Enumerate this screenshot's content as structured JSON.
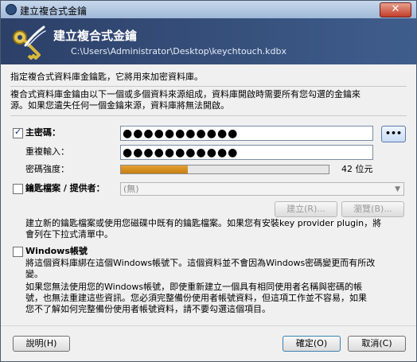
{
  "window": {
    "title": "建立複合式金鑰",
    "close_symbol": "✕"
  },
  "banner": {
    "title": "建立複合式金鑰",
    "path": "C:\\Users\\Administrator\\Desktop\\keychtouch.kdbx"
  },
  "intro": {
    "line1": "指定複合式資料庫金鑰匙，它將用來加密資料庫。",
    "line2": "複合式資料庫金鑰由以下一個或多個資料來源組成，資料庫開啟時需要所有您勾選的金鑰來",
    "line3": "源。如果您遺失任何一個金鑰來源，資料庫將無法開啟。"
  },
  "master_password": {
    "label": "主密碼：",
    "value": "●●●●●●●●●●●",
    "repeat_label": "重複輸入：",
    "repeat_value": "●●●●●●●●●●●",
    "toggle_label": "•••",
    "strength_label": "密碼強度：",
    "strength_text": "42 位元",
    "strength_fraction": 0.32
  },
  "key_file": {
    "label": "鑰匙檔案 / 提供者：",
    "select_value": "(無)",
    "create_label": "建立(R)...",
    "browse_label": "瀏覽(B)...",
    "help_line1": "建立新的鑰匙檔案或使用您磁碟中既有的鑰匙檔案。如果您有安裝key provider plugin，將",
    "help_line2": "會列在下拉式清單中。"
  },
  "windows_account": {
    "label": "Windows帳號",
    "line1": "將這個資料庫綁在這個Windows帳號下。這個資料並不會因為Windows密碼變更而有所改",
    "line2": "變。",
    "line3": "如果您無法使用您的Windows帳號，即使重新建立一個具有相同使用者名稱與密碼的帳",
    "line4": "號，也無法重建這些資訊。您必須完整備份使用者帳號資料，但這項工作並不容易，如果",
    "line5": "您不了解如何完整備份使用者帳號資料，請不要勾選這個項目。"
  },
  "buttons": {
    "help": "說明(H)",
    "ok": "確定(O)",
    "cancel": "取消(C)"
  }
}
